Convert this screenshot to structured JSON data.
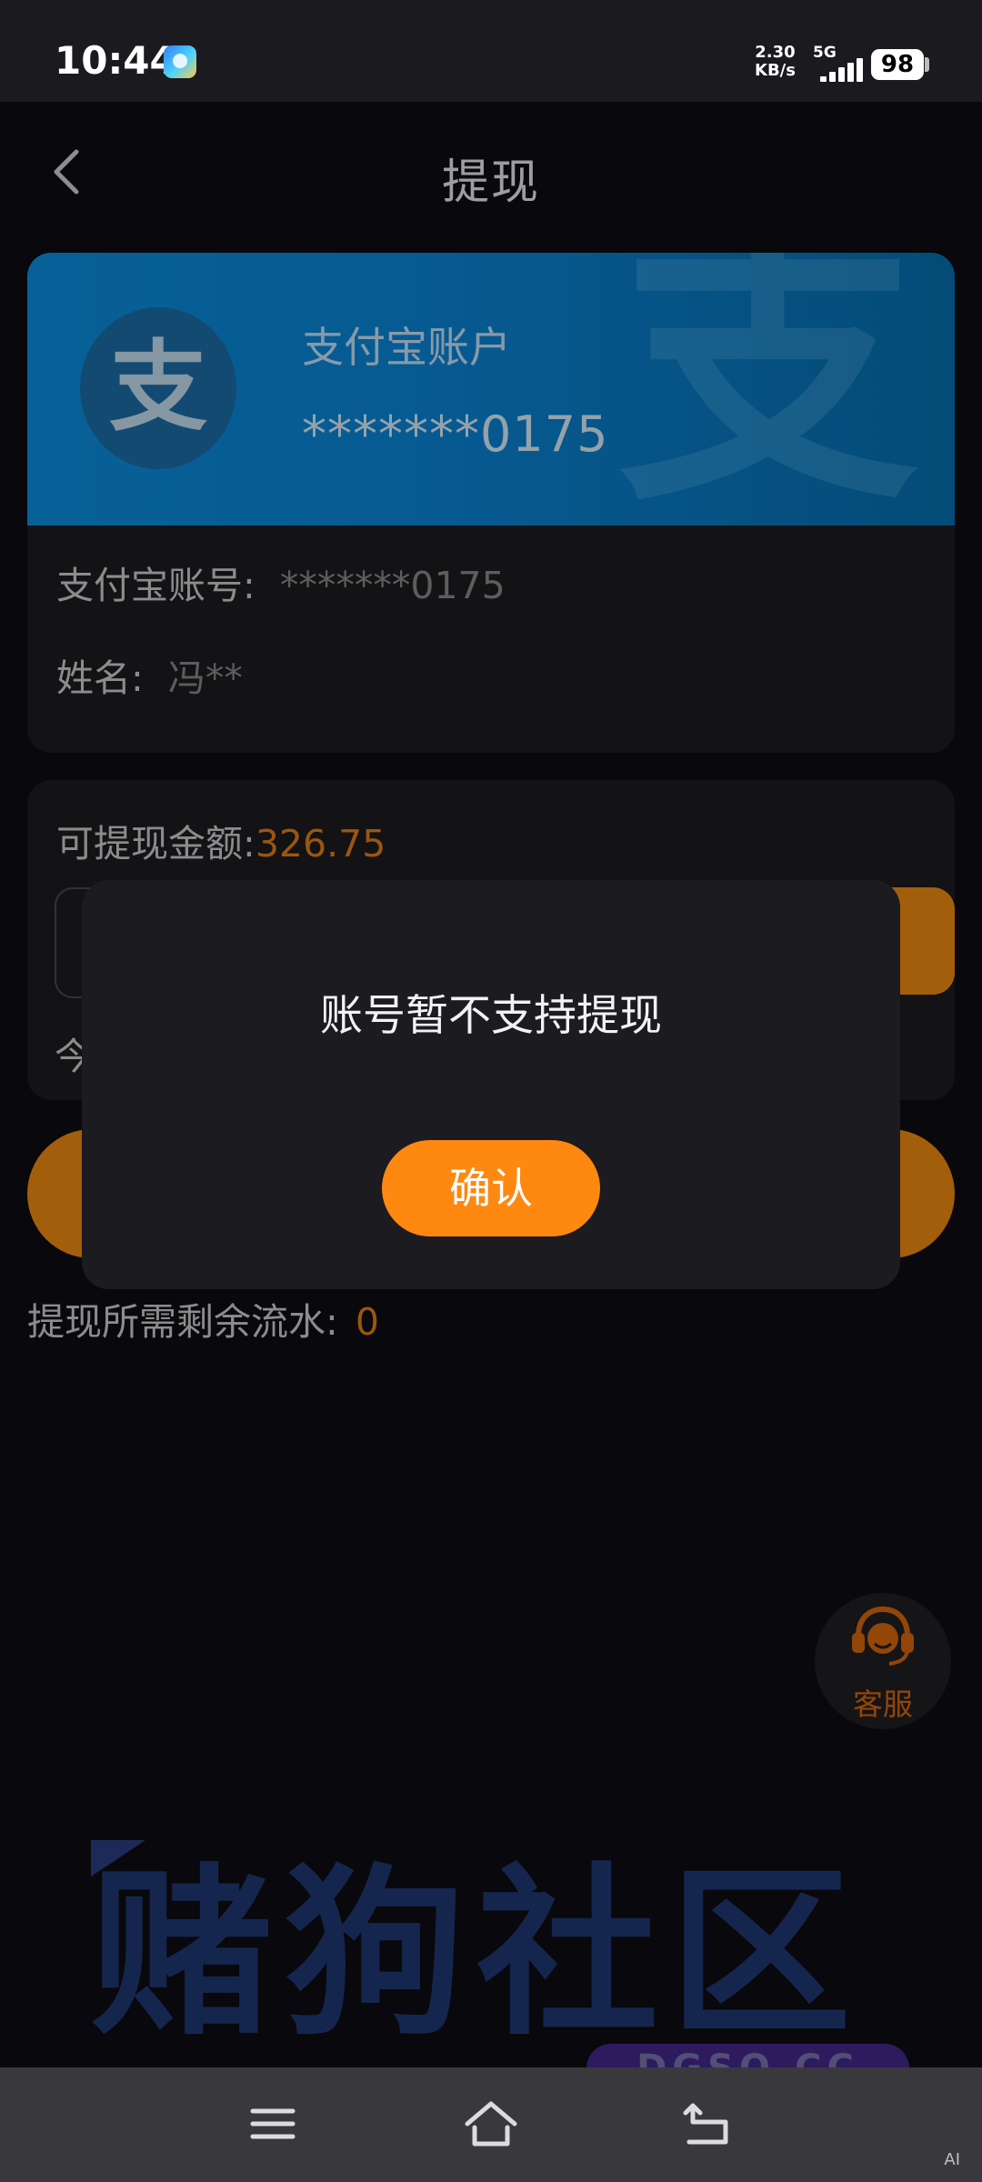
{
  "status_bar": {
    "time": "10:44",
    "net_speed_value": "2.30",
    "net_speed_unit": "KB/s",
    "network": "5G",
    "battery": "98"
  },
  "header": {
    "title": "提现"
  },
  "account_card": {
    "banner_name": "支付宝账户",
    "banner_number": "*******0175",
    "logo_glyph": "支",
    "account_label": "支付宝账号:",
    "account_value": "*******0175",
    "name_label": "姓名:",
    "name_value": "冯**"
  },
  "amount_card": {
    "label": "可提现金额:",
    "value": "326.75",
    "today_text": "今"
  },
  "flow": {
    "label": "提现所需剩余流水:",
    "value": "0"
  },
  "dialog": {
    "message": "账号暂不支持提现",
    "confirm_label": "确认"
  },
  "customer_service": {
    "label": "客服"
  },
  "watermark": {
    "text": "赌狗社区",
    "domain": "DGSQ.CC"
  },
  "nav_corner": "AI",
  "colors": {
    "accent": "#fe8810",
    "amount": "#e48117",
    "alipay_blue": "#0b8fe0"
  },
  "icons": [
    "back-icon",
    "alipay-logo-icon",
    "headset-icon",
    "menu-icon",
    "home-icon",
    "back-nav-icon"
  ]
}
